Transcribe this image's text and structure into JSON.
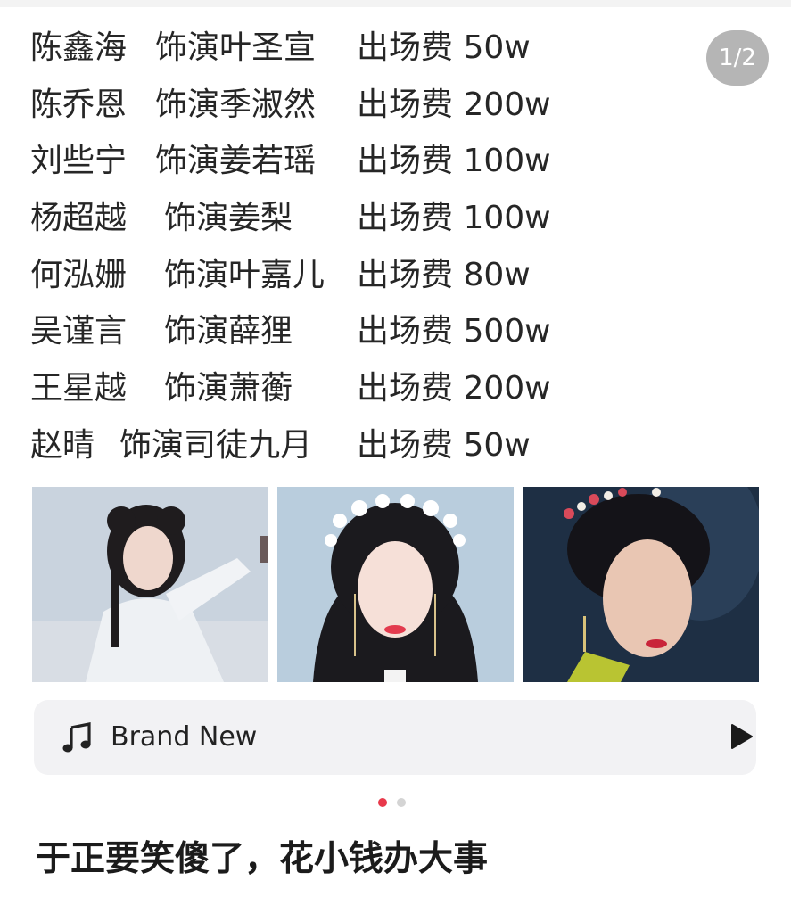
{
  "pager": {
    "label": "1/2"
  },
  "cast": [
    {
      "actor": "陈鑫海",
      "role": "饰演叶圣宣",
      "fee": "出场费 50w"
    },
    {
      "actor": "陈乔恩",
      "role": "饰演季淑然",
      "fee": "出场费 200w"
    },
    {
      "actor": "刘些宁",
      "role": "饰演姜若瑶",
      "fee": "出场费 100w"
    },
    {
      "actor": "杨超越",
      "role": "饰演姜梨",
      "fee": "出场费 100w"
    },
    {
      "actor": "何泓姗",
      "role": "饰演叶嘉儿",
      "fee": "出场费 80w"
    },
    {
      "actor": "吴谨言",
      "role": "饰演薛狸",
      "fee": "出场费 500w"
    },
    {
      "actor": "王星越",
      "role": "饰演萧蘅",
      "fee": "出场费 200w"
    },
    {
      "actor": "赵晴",
      "role": "饰演司徒九月",
      "fee": "出场费 50w"
    }
  ],
  "music": {
    "title": "Brand New",
    "icon": "music-note-icon",
    "play_icon": "play-icon"
  },
  "carousel": {
    "active_index": 0,
    "count": 2,
    "active_color": "#e8394b",
    "inactive_color": "#d4d4d4"
  },
  "caption": "于正要笑傻了，花小钱办大事"
}
